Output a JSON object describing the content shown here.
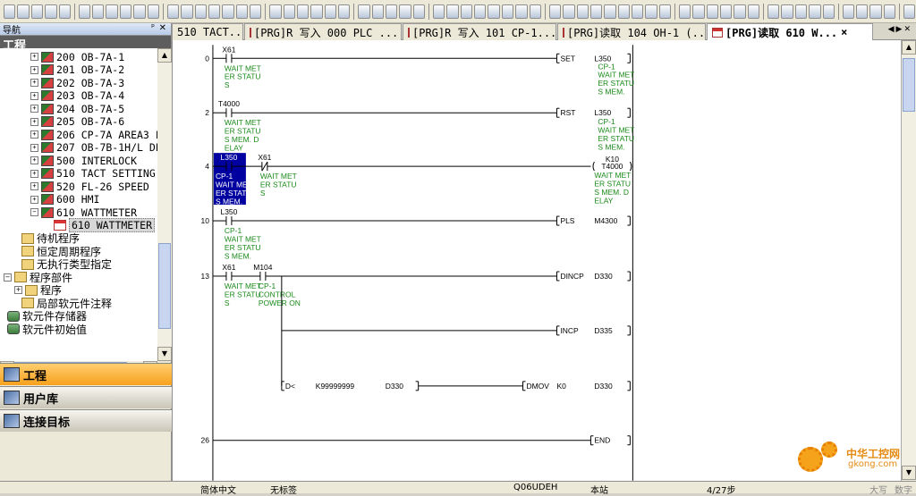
{
  "navigation": {
    "panel_title": "导航",
    "project_header": "工程",
    "tree": [
      {
        "label": "200 OB-7A-1",
        "type": "prog"
      },
      {
        "label": "201 OB-7A-2",
        "type": "prog"
      },
      {
        "label": "202 OB-7A-3",
        "type": "prog"
      },
      {
        "label": "203 OB-7A-4",
        "type": "prog"
      },
      {
        "label": "204 OB-7A-5",
        "type": "prog"
      },
      {
        "label": "205 OB-7A-6",
        "type": "prog"
      },
      {
        "label": "206 CP-7A AREA3 FD",
        "type": "prog"
      },
      {
        "label": "207 OB-7B-1H/L DL-",
        "type": "prog"
      },
      {
        "label": "500 INTERLOCK",
        "type": "prog"
      },
      {
        "label": "510 TACT SETTING",
        "type": "prog"
      },
      {
        "label": "520 FL-26 SPEED",
        "type": "prog"
      },
      {
        "label": "600 HMI",
        "type": "prog"
      },
      {
        "label": "610 WATTMETER",
        "type": "prog"
      },
      {
        "label": "610 WATTMETER",
        "type": "doc"
      },
      {
        "label": "待机程序",
        "type": "fold"
      },
      {
        "label": "恒定周期程序",
        "type": "fold"
      },
      {
        "label": "无执行类型指定",
        "type": "fold"
      },
      {
        "label": "程序部件",
        "type": "fold"
      },
      {
        "label": "程序",
        "type": "fold"
      },
      {
        "label": "局部软元件注释",
        "type": "fold"
      },
      {
        "label": "软元件存储器",
        "type": "db"
      },
      {
        "label": "软元件初始值",
        "type": "db"
      }
    ],
    "bottom_bars": [
      "工程",
      "用户库",
      "连接目标"
    ]
  },
  "tabs": [
    {
      "label": "510 TACT...",
      "icon": false,
      "active": false
    },
    {
      "label": "[PRG]R 写入 000 PLC ...",
      "icon": true,
      "active": false
    },
    {
      "label": "[PRG]R 写入 101 CP-1...",
      "icon": true,
      "active": false
    },
    {
      "label": "[PRG]读取 104 OH-1 (...",
      "icon": true,
      "active": false
    },
    {
      "label": "[PRG]读取 610 W...",
      "icon": true,
      "active": true
    }
  ],
  "ladder": {
    "steps": [
      "0",
      "2",
      "4",
      "10",
      "13",
      "26"
    ],
    "contacts": [
      {
        "dev": "X61",
        "c1": "WAIT MET",
        "c2": "ER STATU",
        "c3": "S"
      },
      {
        "dev": "T4000",
        "c1": "WAIT MET",
        "c2": "ER STATU",
        "c3": "S MEM. D",
        "c4": "ELAY"
      },
      {
        "dev": "L350",
        "c1": "CP-1",
        "c2": "WAIT MET",
        "c3": "ER STATU",
        "c4": "S MEM."
      },
      {
        "dev": "X61",
        "c1": "WAIT MET",
        "c2": "ER STATU",
        "c3": "S"
      },
      {
        "dev": "L350",
        "c1": "CP-1",
        "c2": "WAIT MET",
        "c3": "ER STATU",
        "c4": "S MEM."
      },
      {
        "dev": "X61",
        "c1": "WAIT MET",
        "c2": "ER STATU",
        "c3": "S"
      },
      {
        "dev": "M104",
        "c1": "CP-1",
        "c2": "CONTROL",
        "c3": "POWER ON"
      }
    ],
    "coils": [
      {
        "ins": "SET",
        "dev": "L350",
        "c1": "CP-1",
        "c2": "WAIT MET",
        "c3": "ER STATU",
        "c4": "S MEM."
      },
      {
        "ins": "RST",
        "dev": "L350",
        "c1": "CP-1",
        "c2": "WAIT MET",
        "c3": "ER STATU",
        "c4": "S MEM."
      },
      {
        "ins": "T4000",
        "k": "K10",
        "c1": "WAIT MET",
        "c2": "ER STATU",
        "c3": "S MEM. D",
        "c4": "ELAY"
      },
      {
        "ins": "PLS",
        "dev": "M4300"
      },
      {
        "ins": "DINCP",
        "dev": "D330"
      },
      {
        "ins": "INCP",
        "dev": "D335"
      },
      {
        "ins": "DMOV",
        "k": "K0",
        "dev": "D330"
      },
      {
        "ins": "END"
      }
    ],
    "compare": {
      "op": "D<",
      "a": "K99999999",
      "b": "D330"
    }
  },
  "status": {
    "lang": "简体中文",
    "label": "无标签",
    "cpu": "Q06UDEH",
    "station": "本站",
    "step": "4/27步",
    "caps": "大写",
    "num": "数字"
  },
  "watermark": {
    "title": "中华工控网",
    "url": "gkong.com"
  },
  "colors": {
    "accent": "#f7a11d",
    "comment": "#1a8a1a",
    "selection": "#0000a0"
  }
}
